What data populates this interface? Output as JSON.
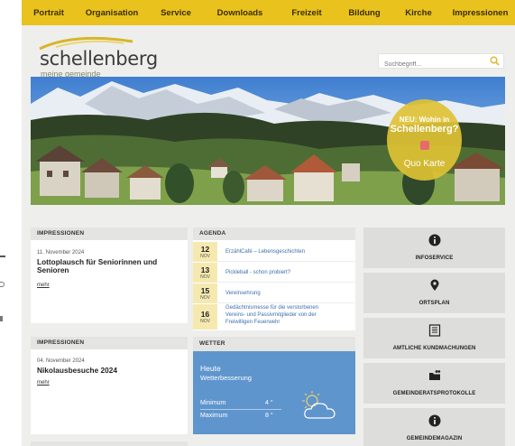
{
  "nav": {
    "items": [
      "Portrait",
      "Organisation",
      "Service",
      "Downloads",
      "Freizeit",
      "Bildung",
      "Kirche",
      "Impressionen"
    ]
  },
  "logo": {
    "name": "schellenberg",
    "tagline": "meine gemeinde"
  },
  "search": {
    "placeholder": "Suchbegriff..."
  },
  "promo": {
    "line1": "NEU: Wohin in",
    "line2": "Schellenberg?",
    "line3": "Quo Karte"
  },
  "impressionen1": {
    "header": "IMPRESSIONEN",
    "date": "11. November 2024",
    "title_line1": "Lottoplausch für Seniorinnen und",
    "title_line2": "Senioren",
    "more": "mehr"
  },
  "impressionen2": {
    "header": "IMPRESSIONEN",
    "date": "04. November 2024",
    "title": "Nikolausbesuche 2024",
    "more": "mehr"
  },
  "agenda": {
    "header": "AGENDA",
    "items": [
      {
        "day": "12",
        "month": "NOV",
        "text": "ErzählCafé – Lebensgeschichten"
      },
      {
        "day": "13",
        "month": "NOV",
        "text": "Pickleball - schon probiert?"
      },
      {
        "day": "15",
        "month": "NOV",
        "text": "Vereinsehrung"
      },
      {
        "day": "16",
        "month": "NOV",
        "text_line1": "Gedächtnismesse für die verstorbenen",
        "text_line2": "Vereins- und Passivmitglieder von der",
        "text_line3": "Freiwilligen Feuerwehr"
      }
    ]
  },
  "weather": {
    "header": "WETTER",
    "day": "Heute",
    "condition": "Wetterbesserung",
    "min_label": "Minimum",
    "min_value": "4 °",
    "max_label": "Maximum",
    "max_value": "8 °"
  },
  "quicklinks": [
    {
      "label": "INFOSERVICE",
      "icon": "info-icon"
    },
    {
      "label": "ORTSPLAN",
      "icon": "map-pin-icon"
    },
    {
      "label": "AMTLICHE KUNDMACHUNGEN",
      "icon": "notice-icon"
    },
    {
      "label": "GEMEINDERATSPROTOKOLLE",
      "icon": "folder-people-icon"
    },
    {
      "label": "GEMEINDEMAGAZIN",
      "icon": "info-icon"
    }
  ],
  "colors": {
    "nav": "#e9c21e",
    "weather": "#5f95cd",
    "agenda_date": "#f5e9b0",
    "link": "#3e6fae"
  }
}
